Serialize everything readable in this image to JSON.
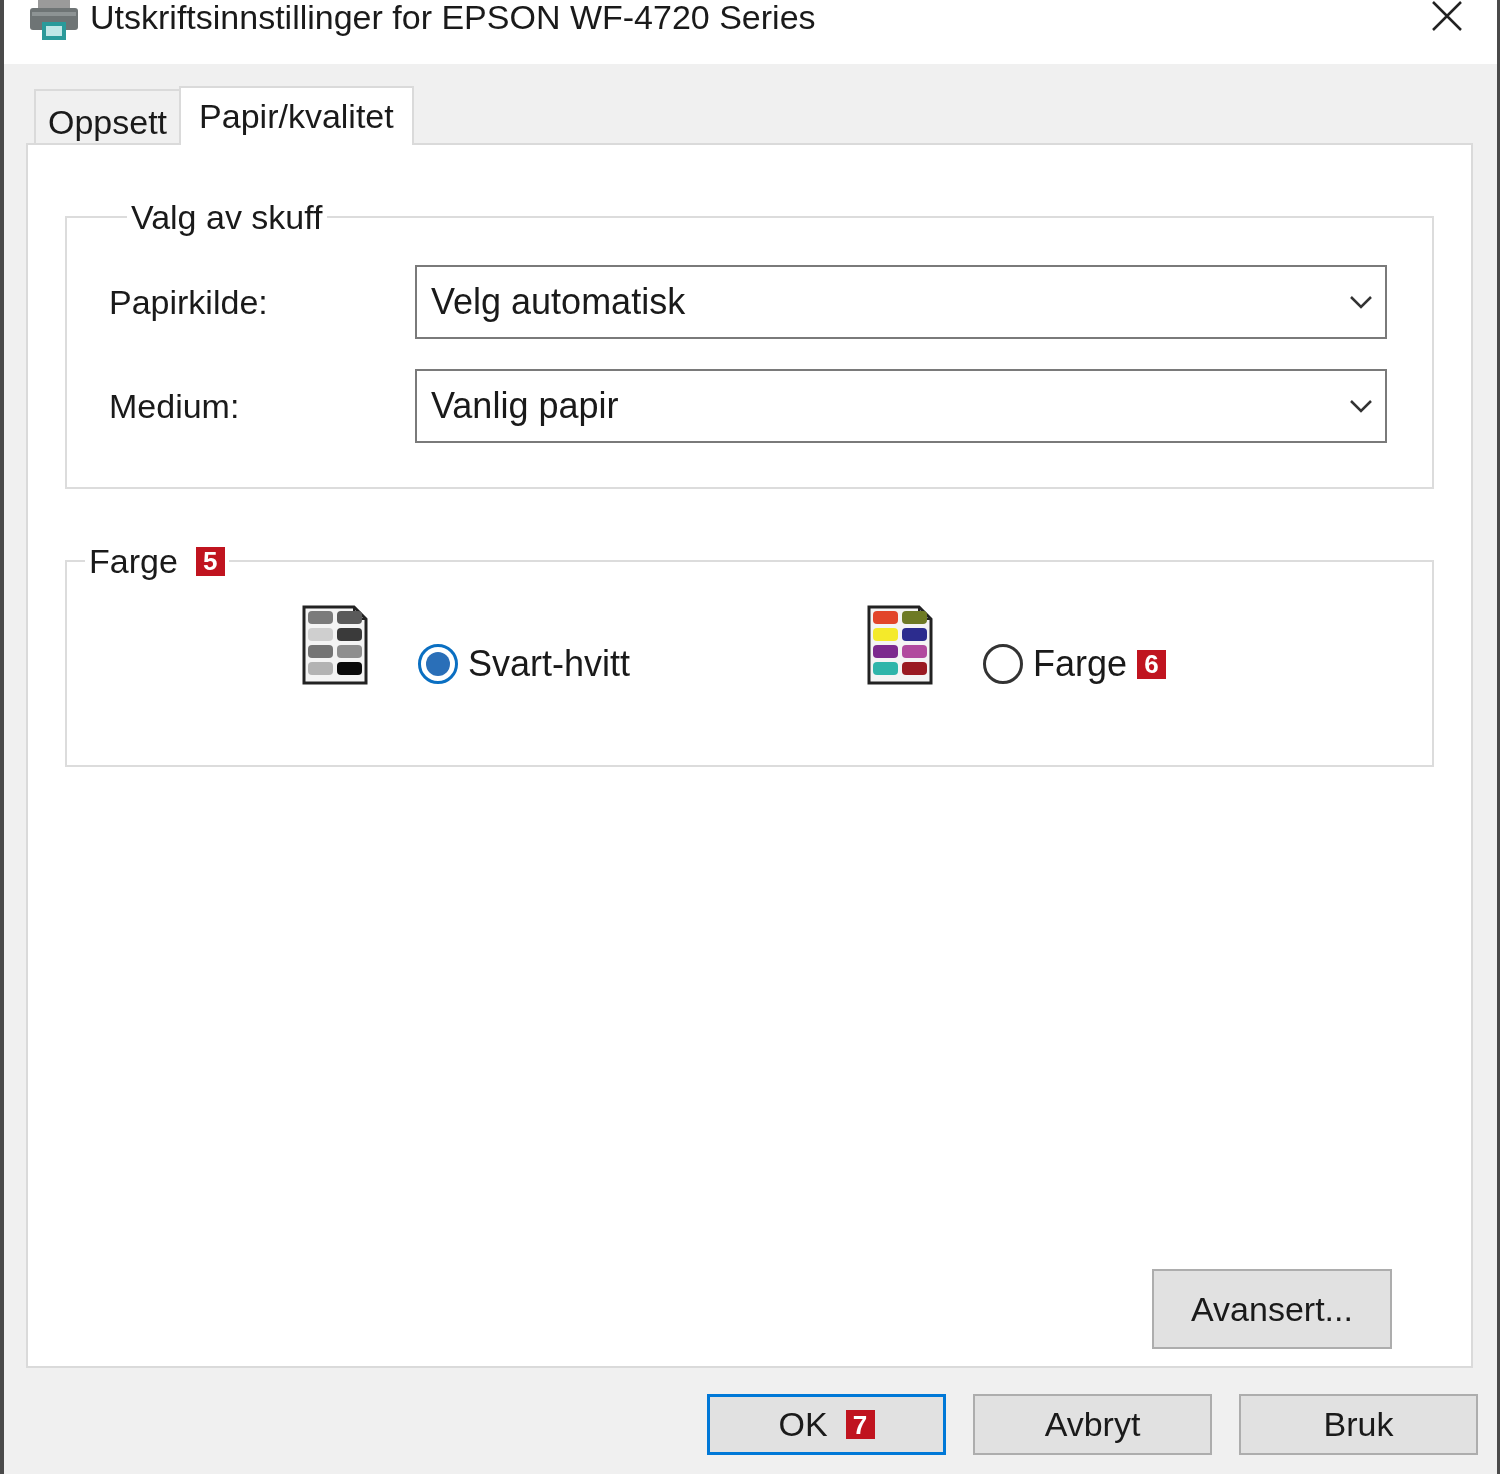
{
  "window": {
    "title": "Utskriftsinnstillinger for EPSON WF-4720 Series"
  },
  "tabs": [
    {
      "label": "Oppsett",
      "selected": false
    },
    {
      "label": "Papir/kvalitet",
      "selected": true
    }
  ],
  "tray_group": {
    "title": "Valg av skuff",
    "fields": [
      {
        "label": "Papirkilde:",
        "value": "Velg automatisk"
      },
      {
        "label": "Medium:",
        "value": "Vanlig papir"
      }
    ]
  },
  "color_group": {
    "title": "Farge",
    "badge": "5",
    "options": [
      {
        "label": "Svart-hvitt",
        "selected": true,
        "kind": "grayscale"
      },
      {
        "label": "Farge",
        "selected": false,
        "kind": "color",
        "badge": "6"
      }
    ]
  },
  "advanced_button": "Avansert...",
  "buttons": [
    {
      "label": "OK",
      "default": true,
      "badge": "7"
    },
    {
      "label": "Avbryt",
      "default": false
    },
    {
      "label": "Bruk",
      "default": false
    }
  ]
}
